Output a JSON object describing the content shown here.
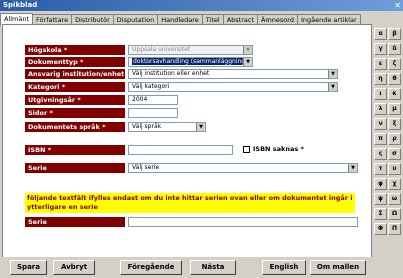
{
  "window": {
    "title": "Spikblad",
    "close": "✕"
  },
  "tabs": [
    "Allmänt",
    "Författare",
    "Distributör",
    "Disputation",
    "Handledare",
    "Titel",
    "Abstract",
    "Ämnesord",
    "Ingående artiklar"
  ],
  "form": {
    "hogskola": {
      "label": "Högskola *",
      "value": "Uppsala universitet"
    },
    "dokumenttyp": {
      "label": "Dokumenttyp *",
      "value": "doktorsavhandling (sammanläggning)"
    },
    "ansvarig": {
      "label": "Ansvarig institution/enhet *",
      "value": "Välj institution eller enhet"
    },
    "kategori": {
      "label": "Kategori *",
      "value": "Välj kategori"
    },
    "utgivningsar": {
      "label": "Utgivningsår *",
      "value": "2004"
    },
    "sidor": {
      "label": "Sidor *",
      "value": ""
    },
    "sprak": {
      "label": "Dokumentets språk *",
      "value": "Välj språk"
    },
    "isbn": {
      "label": "ISBN *",
      "value": "",
      "missing_label": "ISBN saknas *"
    },
    "serie": {
      "label": "Serie",
      "value": "Välj serie"
    },
    "info_text": "följande textfält ifylles endast om du inte hittar serien ovan eller om dokumentet ingår i ytterligare en serie",
    "serie2": {
      "label": "Serie",
      "value": ""
    }
  },
  "greek": [
    "α",
    "β",
    "γ",
    "δ",
    "ε",
    "ζ",
    "η",
    "θ",
    "ι",
    "κ",
    "λ",
    "μ",
    "ν",
    "ξ",
    "π",
    "ρ",
    "ς",
    "σ",
    "τ",
    "υ",
    "φ",
    "χ",
    "ψ",
    "ω",
    "Σ",
    "Ω",
    "Φ",
    "Π"
  ],
  "buttons": {
    "spara": "Spara",
    "avbryt": "Avbryt",
    "foregaende": "Föregående",
    "nasta": "Nästa",
    "english": "English",
    "om_mallen": "Om mallen"
  }
}
